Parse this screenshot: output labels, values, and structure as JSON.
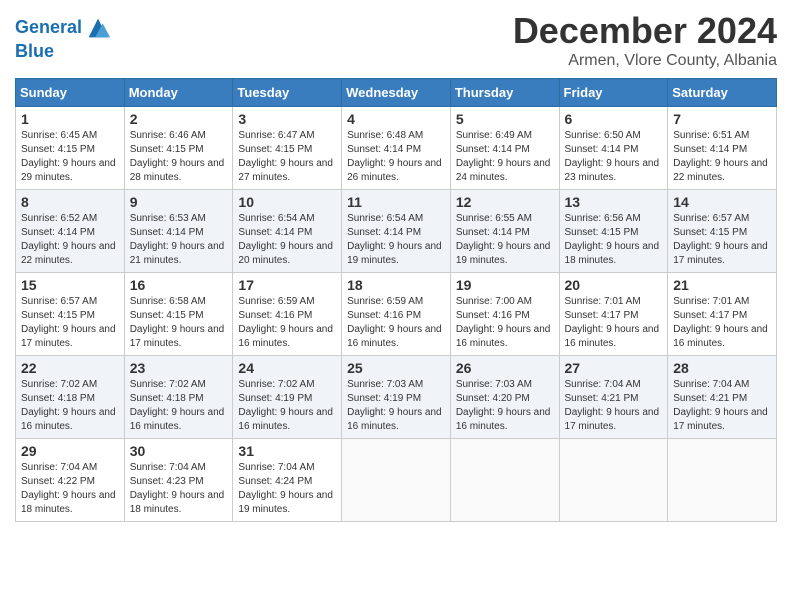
{
  "header": {
    "logo_line1": "General",
    "logo_line2": "Blue",
    "month": "December 2024",
    "location": "Armen, Vlore County, Albania"
  },
  "days_of_week": [
    "Sunday",
    "Monday",
    "Tuesday",
    "Wednesday",
    "Thursday",
    "Friday",
    "Saturday"
  ],
  "weeks": [
    [
      {
        "day": "1",
        "sunrise": "6:45 AM",
        "sunset": "4:15 PM",
        "daylight": "9 hours and 29 minutes."
      },
      {
        "day": "2",
        "sunrise": "6:46 AM",
        "sunset": "4:15 PM",
        "daylight": "9 hours and 28 minutes."
      },
      {
        "day": "3",
        "sunrise": "6:47 AM",
        "sunset": "4:15 PM",
        "daylight": "9 hours and 27 minutes."
      },
      {
        "day": "4",
        "sunrise": "6:48 AM",
        "sunset": "4:14 PM",
        "daylight": "9 hours and 26 minutes."
      },
      {
        "day": "5",
        "sunrise": "6:49 AM",
        "sunset": "4:14 PM",
        "daylight": "9 hours and 24 minutes."
      },
      {
        "day": "6",
        "sunrise": "6:50 AM",
        "sunset": "4:14 PM",
        "daylight": "9 hours and 23 minutes."
      },
      {
        "day": "7",
        "sunrise": "6:51 AM",
        "sunset": "4:14 PM",
        "daylight": "9 hours and 22 minutes."
      }
    ],
    [
      {
        "day": "8",
        "sunrise": "6:52 AM",
        "sunset": "4:14 PM",
        "daylight": "9 hours and 22 minutes."
      },
      {
        "day": "9",
        "sunrise": "6:53 AM",
        "sunset": "4:14 PM",
        "daylight": "9 hours and 21 minutes."
      },
      {
        "day": "10",
        "sunrise": "6:54 AM",
        "sunset": "4:14 PM",
        "daylight": "9 hours and 20 minutes."
      },
      {
        "day": "11",
        "sunrise": "6:54 AM",
        "sunset": "4:14 PM",
        "daylight": "9 hours and 19 minutes."
      },
      {
        "day": "12",
        "sunrise": "6:55 AM",
        "sunset": "4:14 PM",
        "daylight": "9 hours and 19 minutes."
      },
      {
        "day": "13",
        "sunrise": "6:56 AM",
        "sunset": "4:15 PM",
        "daylight": "9 hours and 18 minutes."
      },
      {
        "day": "14",
        "sunrise": "6:57 AM",
        "sunset": "4:15 PM",
        "daylight": "9 hours and 17 minutes."
      }
    ],
    [
      {
        "day": "15",
        "sunrise": "6:57 AM",
        "sunset": "4:15 PM",
        "daylight": "9 hours and 17 minutes."
      },
      {
        "day": "16",
        "sunrise": "6:58 AM",
        "sunset": "4:15 PM",
        "daylight": "9 hours and 17 minutes."
      },
      {
        "day": "17",
        "sunrise": "6:59 AM",
        "sunset": "4:16 PM",
        "daylight": "9 hours and 16 minutes."
      },
      {
        "day": "18",
        "sunrise": "6:59 AM",
        "sunset": "4:16 PM",
        "daylight": "9 hours and 16 minutes."
      },
      {
        "day": "19",
        "sunrise": "7:00 AM",
        "sunset": "4:16 PM",
        "daylight": "9 hours and 16 minutes."
      },
      {
        "day": "20",
        "sunrise": "7:01 AM",
        "sunset": "4:17 PM",
        "daylight": "9 hours and 16 minutes."
      },
      {
        "day": "21",
        "sunrise": "7:01 AM",
        "sunset": "4:17 PM",
        "daylight": "9 hours and 16 minutes."
      }
    ],
    [
      {
        "day": "22",
        "sunrise": "7:02 AM",
        "sunset": "4:18 PM",
        "daylight": "9 hours and 16 minutes."
      },
      {
        "day": "23",
        "sunrise": "7:02 AM",
        "sunset": "4:18 PM",
        "daylight": "9 hours and 16 minutes."
      },
      {
        "day": "24",
        "sunrise": "7:02 AM",
        "sunset": "4:19 PM",
        "daylight": "9 hours and 16 minutes."
      },
      {
        "day": "25",
        "sunrise": "7:03 AM",
        "sunset": "4:19 PM",
        "daylight": "9 hours and 16 minutes."
      },
      {
        "day": "26",
        "sunrise": "7:03 AM",
        "sunset": "4:20 PM",
        "daylight": "9 hours and 16 minutes."
      },
      {
        "day": "27",
        "sunrise": "7:04 AM",
        "sunset": "4:21 PM",
        "daylight": "9 hours and 17 minutes."
      },
      {
        "day": "28",
        "sunrise": "7:04 AM",
        "sunset": "4:21 PM",
        "daylight": "9 hours and 17 minutes."
      }
    ],
    [
      {
        "day": "29",
        "sunrise": "7:04 AM",
        "sunset": "4:22 PM",
        "daylight": "9 hours and 18 minutes."
      },
      {
        "day": "30",
        "sunrise": "7:04 AM",
        "sunset": "4:23 PM",
        "daylight": "9 hours and 18 minutes."
      },
      {
        "day": "31",
        "sunrise": "7:04 AM",
        "sunset": "4:24 PM",
        "daylight": "9 hours and 19 minutes."
      },
      null,
      null,
      null,
      null
    ]
  ]
}
